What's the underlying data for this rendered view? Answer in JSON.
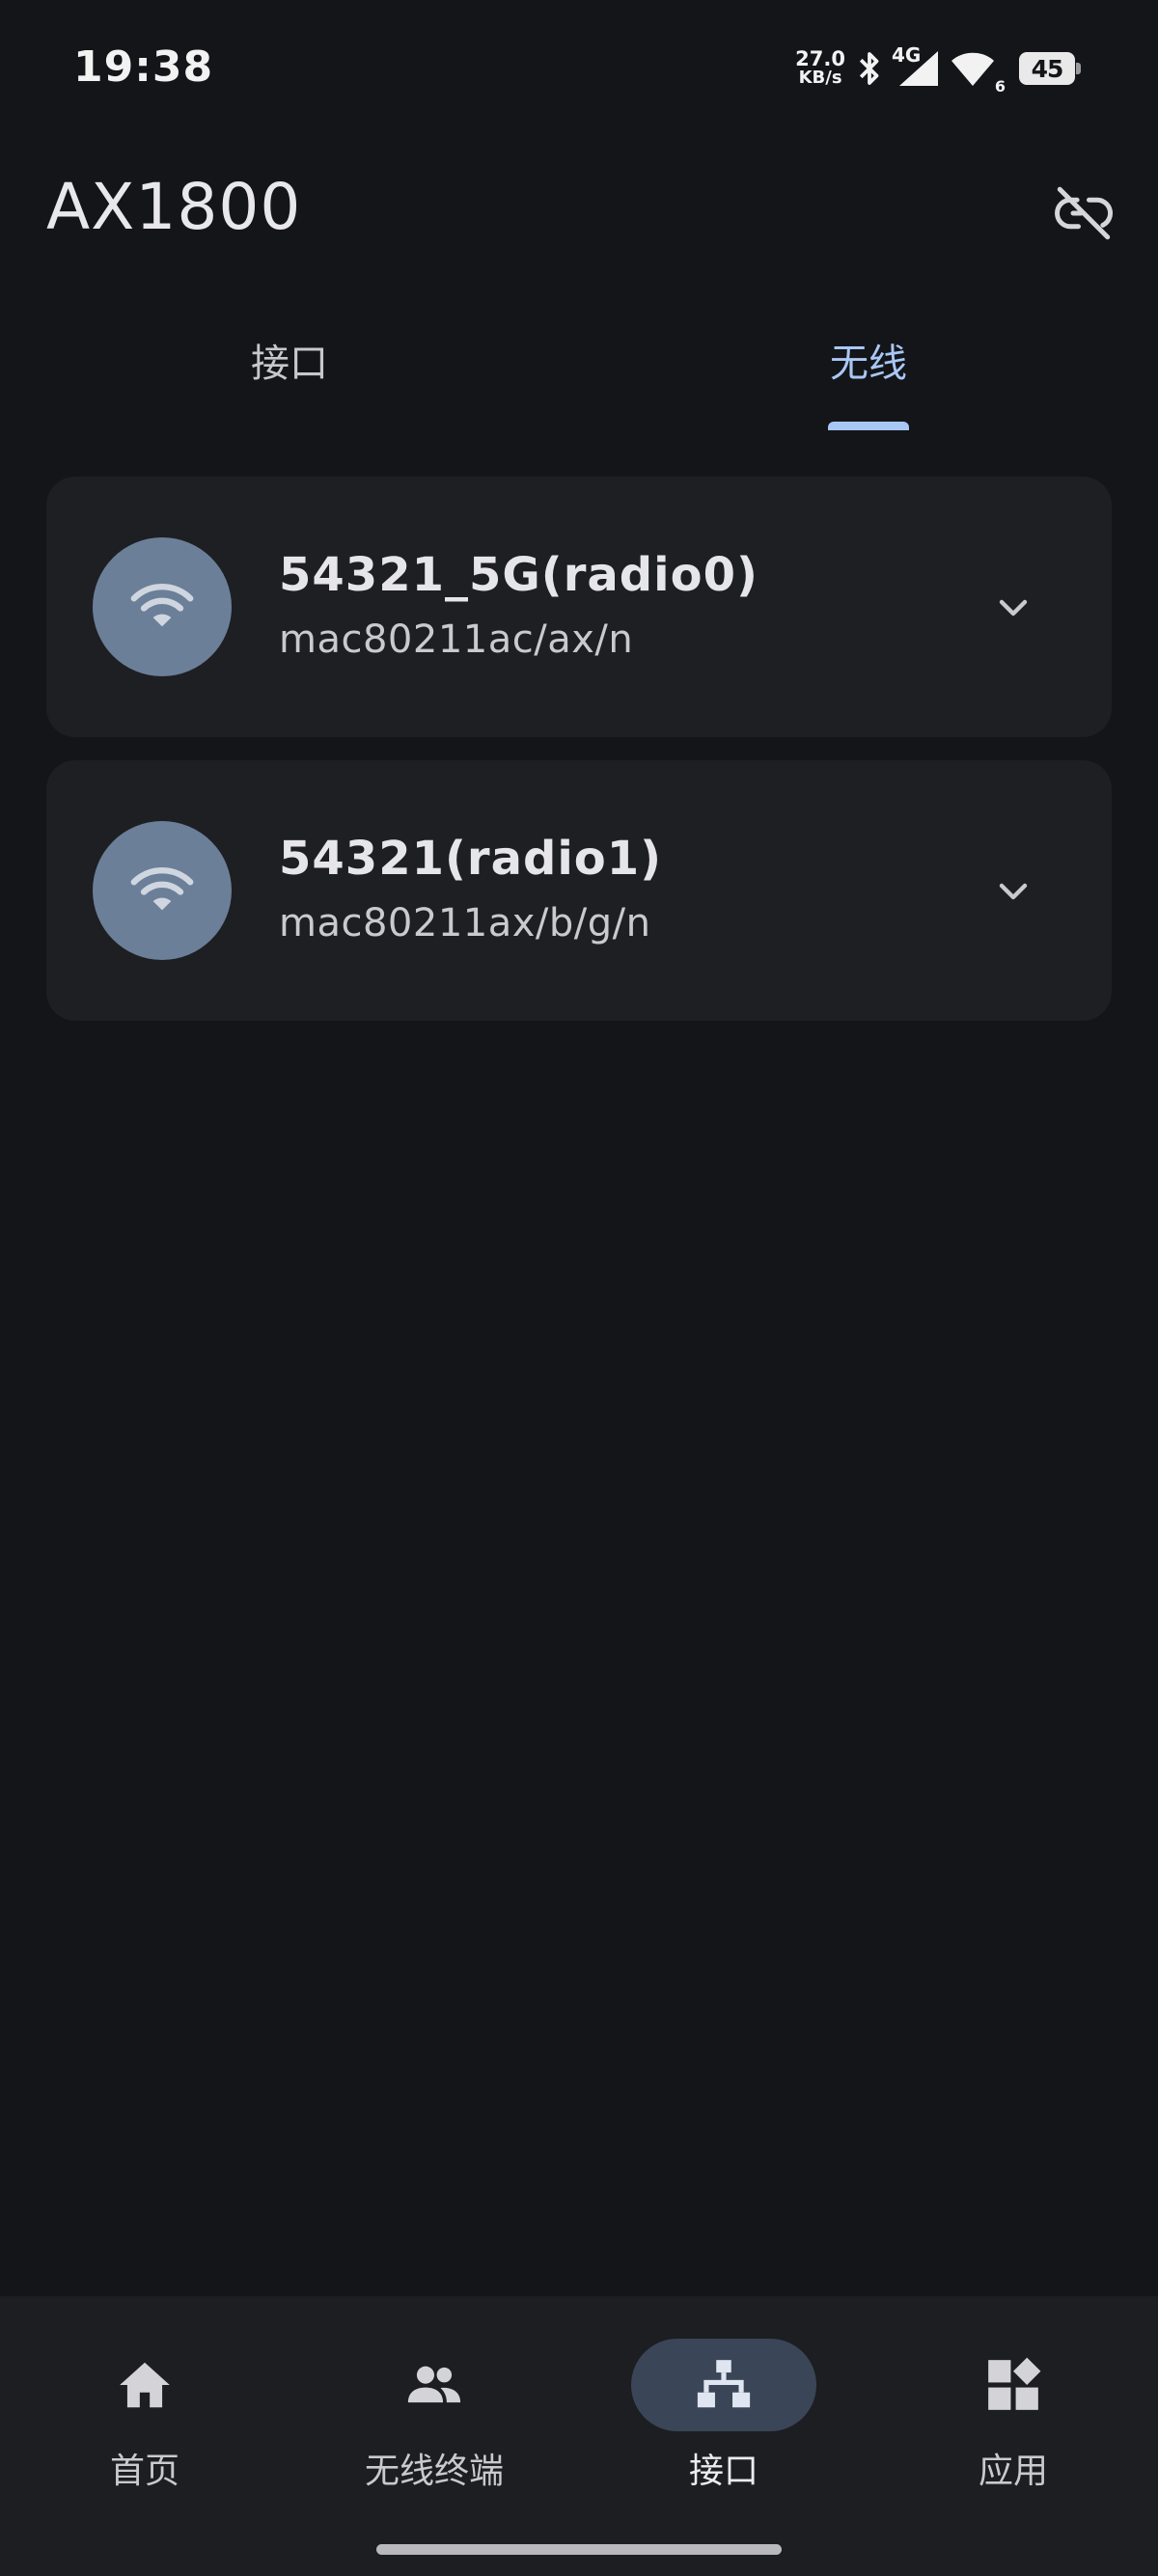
{
  "status_bar": {
    "time": "19:38",
    "net_speed_value": "27.0",
    "net_speed_unit": "KB/s",
    "cellular": "4G",
    "wifi_sub": "6",
    "battery": "45",
    "icons": [
      "bluetooth-icon",
      "cellular-signal-icon",
      "wifi-signal-icon",
      "battery-icon"
    ]
  },
  "header": {
    "title": "AX1800",
    "action_icon": "link-off-icon"
  },
  "tabs": [
    {
      "label": "接口",
      "active": false
    },
    {
      "label": "无线",
      "active": true
    }
  ],
  "radios": [
    {
      "name": "54321_5G(radio0)",
      "detail": "mac80211ac/ax/n",
      "icon": "wifi-icon"
    },
    {
      "name": "54321(radio1)",
      "detail": "mac80211ax/b/g/n",
      "icon": "wifi-icon"
    }
  ],
  "bottom_nav": [
    {
      "label": "首页",
      "icon": "home-icon",
      "active": false
    },
    {
      "label": "无线终端",
      "icon": "people-icon",
      "active": false
    },
    {
      "label": "接口",
      "icon": "network-topology-icon",
      "active": true
    },
    {
      "label": "应用",
      "icon": "apps-icon",
      "active": false
    }
  ],
  "colors": {
    "background": "#141519",
    "card": "#1e1f23",
    "accent": "#a9c7f5",
    "icon_circle": "#6b7f99",
    "nav_active_pill": "#3a4657"
  }
}
